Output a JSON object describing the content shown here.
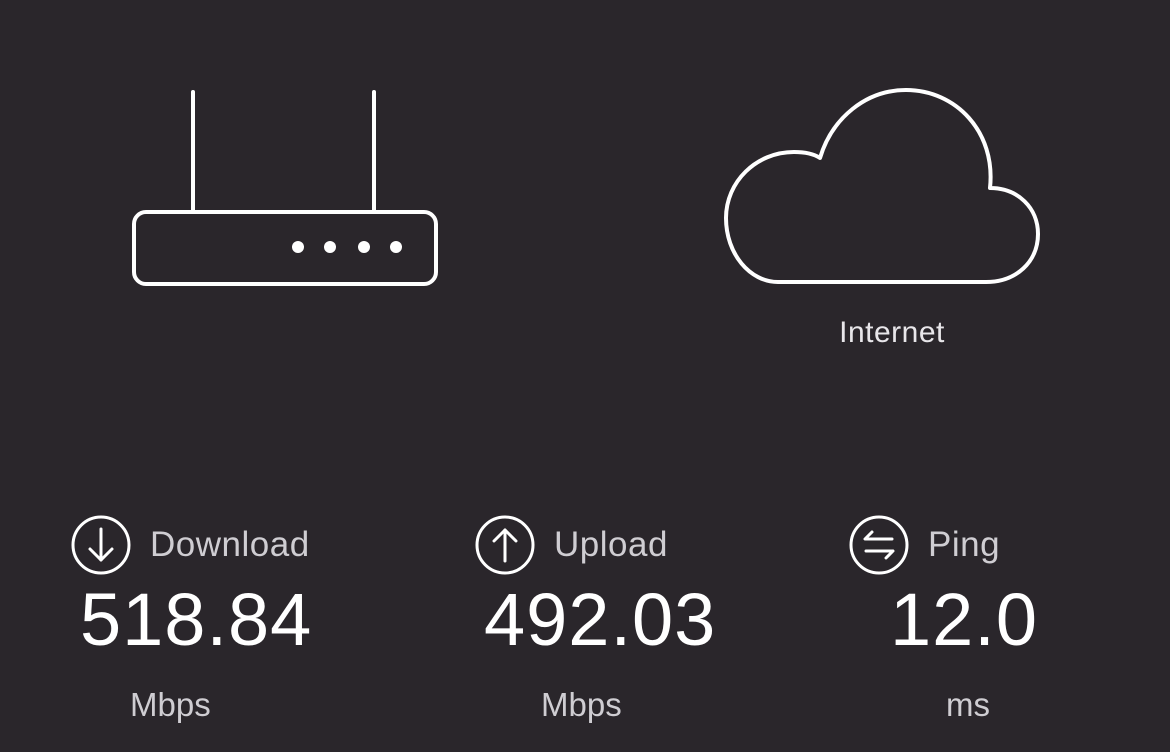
{
  "nodes": {
    "router_icon": "router-icon",
    "cloud_icon": "cloud-icon",
    "internet_label": "Internet"
  },
  "metrics": {
    "download": {
      "icon": "arrow-down-circle-icon",
      "label": "Download",
      "value": "518.84",
      "unit": "Mbps"
    },
    "upload": {
      "icon": "arrow-up-circle-icon",
      "label": "Upload",
      "value": "492.03",
      "unit": "Mbps"
    },
    "ping": {
      "icon": "arrows-swap-circle-icon",
      "label": "Ping",
      "value": "12.0",
      "unit": "ms"
    }
  },
  "colors": {
    "background": "#2a262b",
    "foreground": "#ffffff",
    "muted_text": "#cfcdd2"
  }
}
